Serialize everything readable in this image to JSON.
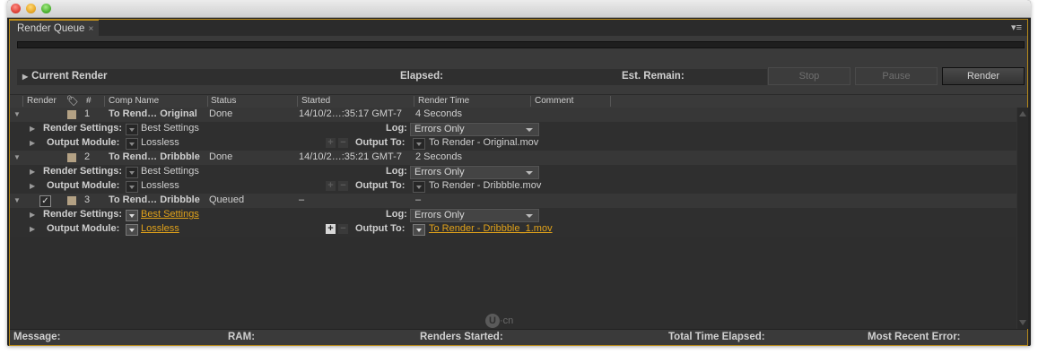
{
  "panel": {
    "tab_label": "Render Queue",
    "tab_close": "×",
    "menu_icon": "▾≡"
  },
  "current_render": {
    "title": "Current Render",
    "elapsed_label": "Elapsed:",
    "remain_label": "Est. Remain:"
  },
  "buttons": {
    "stop": "Stop",
    "pause": "Pause",
    "render": "Render"
  },
  "columns": {
    "render": "Render",
    "number": "#",
    "comp_name": "Comp Name",
    "status": "Status",
    "started": "Started",
    "render_time": "Render Time",
    "comment": "Comment"
  },
  "labels": {
    "render_settings": "Render Settings:",
    "output_module": "Output Module:",
    "log": "Log:",
    "output_to": "Output To:"
  },
  "items": [
    {
      "number": "1",
      "comp_name": "To Rend… Original",
      "status": "Done",
      "started": "14/10/2…:35:17 GMT-7",
      "render_time": "4 Seconds",
      "render_settings": "Best Settings",
      "log": "Errors Only",
      "output_module": "Lossless",
      "output_to": "To Render - Original.mov",
      "checked": false
    },
    {
      "number": "2",
      "comp_name": "To Rend… Dribbble",
      "status": "Done",
      "started": "14/10/2…:35:21 GMT-7",
      "render_time": "2 Seconds",
      "render_settings": "Best Settings",
      "log": "Errors Only",
      "output_module": "Lossless",
      "output_to": "To Render - Dribbble.mov",
      "checked": false
    },
    {
      "number": "3",
      "comp_name": "To Rend… Dribbble",
      "status": "Queued",
      "started": "–",
      "render_time": "–",
      "render_settings": "Best Settings",
      "log": "Errors Only",
      "output_module": "Lossless",
      "output_to": "To Render - Dribbble_1.mov",
      "checked": true,
      "check_mark": "✓"
    }
  ],
  "watermark": {
    "glyph": "U",
    "text": "·cn"
  },
  "footer": {
    "message": "Message:",
    "ram": "RAM:",
    "renders_started": "Renders Started:",
    "total_time": "Total Time Elapsed:",
    "recent_error": "Most Recent Error:"
  },
  "colors": {
    "accent": "#e1a21a",
    "label_swatch": "#b3a184",
    "panel_bg": "#3a3a3a"
  }
}
